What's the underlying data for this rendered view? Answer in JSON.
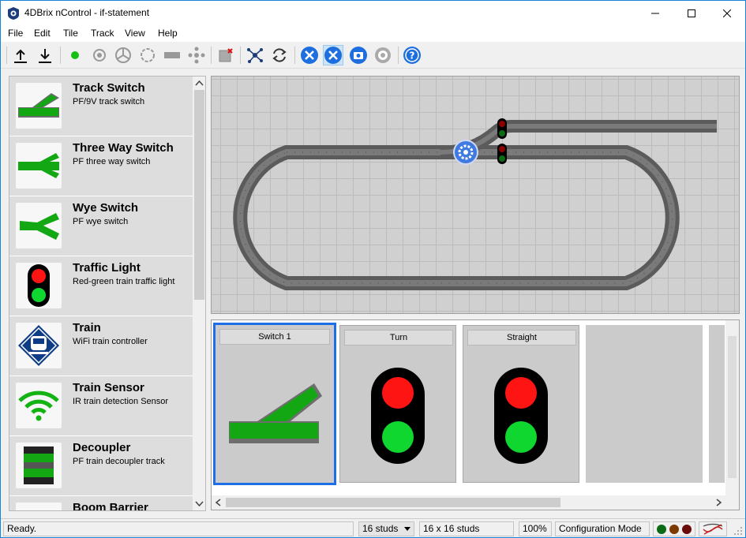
{
  "window": {
    "title": "4DBrix nControl - if-statement"
  },
  "menu": [
    "File",
    "Edit",
    "Tile",
    "Track",
    "View",
    "Help"
  ],
  "toolbar": {
    "tools": [
      "upload-icon",
      "download-icon",
      "green-dot-icon",
      "sensor-icon",
      "turntable-icon",
      "circle-track-icon",
      "decoupler-icon",
      "move-icon",
      "delete-tile-icon",
      "network-icon",
      "refresh-icon",
      "tools-icon",
      "tools-active-icon",
      "camera-icon",
      "settings-icon",
      "help-icon"
    ]
  },
  "palette": {
    "items": [
      {
        "title": "Track Switch",
        "subtitle": "PF/9V track switch"
      },
      {
        "title": "Three Way Switch",
        "subtitle": "PF three way switch"
      },
      {
        "title": "Wye Switch",
        "subtitle": "PF wye switch"
      },
      {
        "title": "Traffic Light",
        "subtitle": "Red-green train traffic light"
      },
      {
        "title": "Train",
        "subtitle": "WiFi train controller"
      },
      {
        "title": "Train Sensor",
        "subtitle": "IR train detection Sensor"
      },
      {
        "title": "Decoupler",
        "subtitle": "PF train decoupler track"
      },
      {
        "title": "Boom Barrier",
        "subtitle": ""
      }
    ]
  },
  "control_tiles": [
    {
      "label": "Switch 1",
      "type": "switch"
    },
    {
      "label": "Turn",
      "type": "traffic-light"
    },
    {
      "label": "Straight",
      "type": "traffic-light"
    }
  ],
  "status": {
    "message": "Ready.",
    "grid_size": "16 studs",
    "grid_dims": "16 x 16 studs",
    "zoom": "100%",
    "mode": "Configuration Mode"
  },
  "colors": {
    "accent": "#1e6fe6",
    "track_green": "#13a813",
    "signal_red": "#ff1414",
    "signal_green": "#10d630"
  }
}
